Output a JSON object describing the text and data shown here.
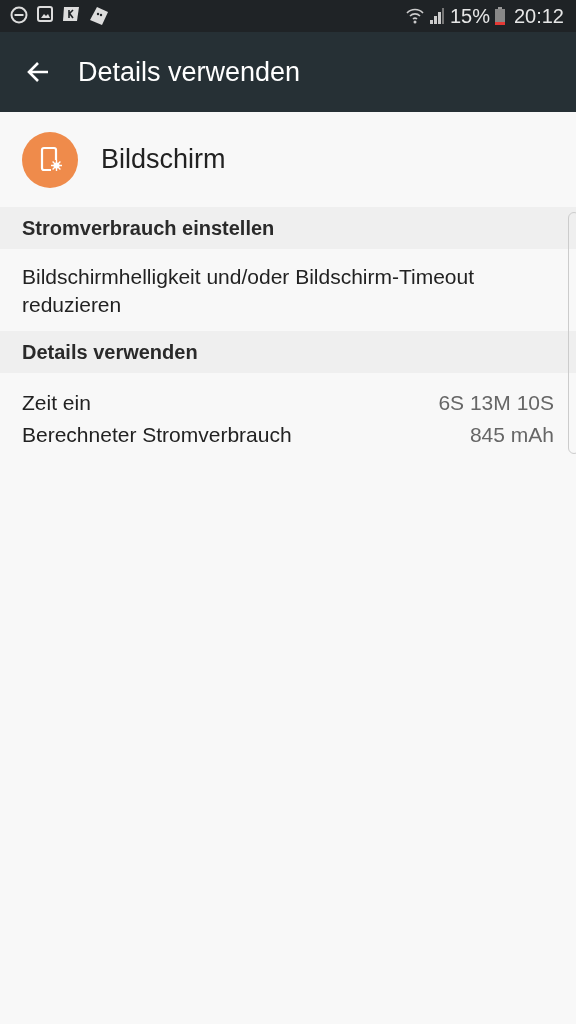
{
  "status_bar": {
    "battery": "15%",
    "time": "20:12"
  },
  "app_bar": {
    "title": "Details verwenden"
  },
  "app": {
    "name": "Bildschirm"
  },
  "sections": [
    {
      "header": "Stromverbrauch einstellen",
      "kind": "text",
      "text": "Bildschirmhelligkeit und/oder Bildschirm-Timeout reduzieren"
    },
    {
      "header": "Details verwenden",
      "kind": "rows",
      "rows": [
        {
          "label": "Zeit ein",
          "value": "6S 13M 10S"
        },
        {
          "label": "Berechneter Stromverbrauch",
          "value": "845 mAh"
        }
      ]
    }
  ]
}
